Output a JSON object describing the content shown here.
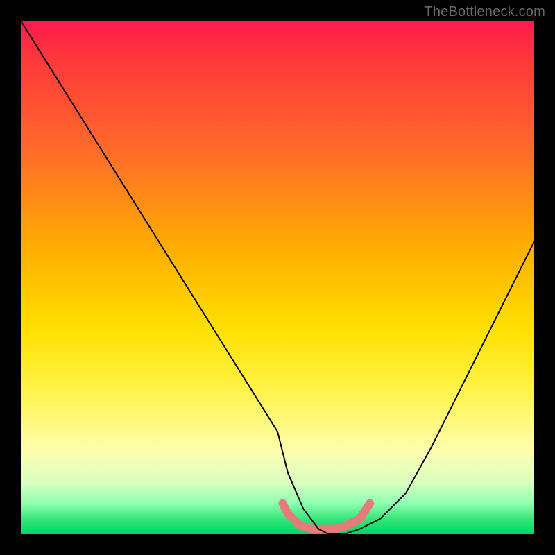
{
  "watermark": "TheBottleneck.com",
  "chart_data": {
    "type": "line",
    "title": "",
    "xlabel": "",
    "ylabel": "",
    "xlim": [
      0,
      100
    ],
    "ylim": [
      0,
      100
    ],
    "grid": false,
    "legend": false,
    "series": [
      {
        "name": "bottleneck-curve",
        "x": [
          0,
          5,
          10,
          15,
          20,
          25,
          30,
          35,
          40,
          45,
          50,
          52,
          55,
          58,
          60,
          63,
          66,
          70,
          75,
          80,
          85,
          90,
          95,
          100
        ],
        "y": [
          100,
          92,
          84,
          76,
          68,
          60,
          52,
          44,
          36,
          28,
          20,
          12,
          5,
          1,
          0,
          0,
          1,
          3,
          8,
          17,
          27,
          37,
          47,
          57
        ]
      },
      {
        "name": "bottleneck-zone-marker",
        "x": [
          51,
          52,
          53,
          54,
          55,
          56,
          57,
          58,
          59,
          60,
          61,
          62,
          63,
          64,
          65,
          66,
          67,
          68
        ],
        "y": [
          6,
          4,
          3,
          2,
          1.5,
          1.2,
          1,
          1,
          1,
          1,
          1,
          1.2,
          1.5,
          2,
          2.5,
          3,
          4.5,
          6
        ]
      }
    ],
    "styles": {
      "bottleneck-curve": {
        "stroke": "#000000",
        "stroke_width": 2,
        "fill": "none"
      },
      "bottleneck-zone-marker": {
        "stroke": "#e77a7a",
        "stroke_width": 12,
        "fill": "none",
        "linecap": "round"
      }
    }
  }
}
